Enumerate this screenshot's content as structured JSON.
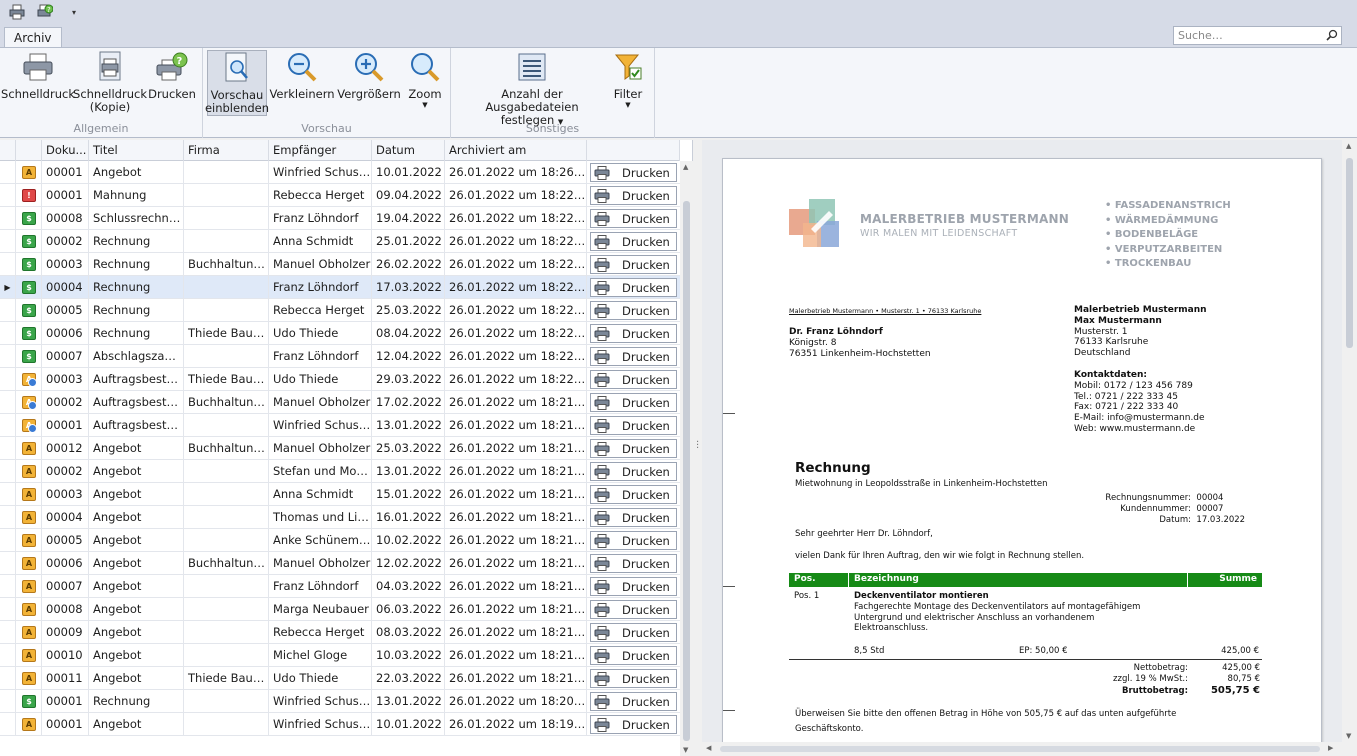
{
  "qat": {
    "icons": [
      "print-icon",
      "print-preview-icon"
    ],
    "menu_arrow": "▾"
  },
  "tabs": [
    {
      "label": "Archiv"
    }
  ],
  "search": {
    "placeholder": "Suche…"
  },
  "ribbon": {
    "groups": [
      {
        "label": "Allgemein",
        "buttons": [
          {
            "line1": "Schnelldruck",
            "line2": ""
          },
          {
            "line1": "Schnelldruck",
            "line2": "(Kopie)"
          },
          {
            "line1": "Drucken",
            "line2": ""
          }
        ]
      },
      {
        "label": "Vorschau",
        "buttons": [
          {
            "line1": "Vorschau",
            "line2": "einblenden"
          },
          {
            "line1": "Verkleinern",
            "line2": ""
          },
          {
            "line1": "Vergrößern",
            "line2": ""
          },
          {
            "line1": "Zoom",
            "line2": ""
          }
        ]
      },
      {
        "label": "Sonstiges",
        "buttons": [
          {
            "line1": "Anzahl der",
            "line2": "Ausgabedateien festlegen"
          },
          {
            "line1": "Filter",
            "line2": ""
          }
        ]
      }
    ]
  },
  "grid": {
    "columns": [
      "Doku...",
      "Titel",
      "Firma",
      "Empfänger",
      "Datum",
      "Archiviert am"
    ],
    "print_label": "Drucken",
    "selected_index": 5,
    "row_indicator": "▶",
    "rows": [
      {
        "type": "angebot",
        "doc": "00001",
        "title": "Angebot",
        "firma": "",
        "recipient": "Winfried Schuster",
        "date": "10.01.2022",
        "archived": "26.01.2022 um 18:26:13 ..."
      },
      {
        "type": "mahnung",
        "doc": "00001",
        "title": "Mahnung",
        "firma": "",
        "recipient": "Rebecca Herget",
        "date": "09.04.2022",
        "archived": "26.01.2022 um 18:22:42 ..."
      },
      {
        "type": "rechnung",
        "doc": "00008",
        "title": "Schlussrechnung",
        "firma": "",
        "recipient": "Franz Löhndorf",
        "date": "19.04.2022",
        "archived": "26.01.2022 um 18:22:28 ..."
      },
      {
        "type": "rechnung",
        "doc": "00002",
        "title": "Rechnung",
        "firma": "",
        "recipient": "Anna Schmidt",
        "date": "25.01.2022",
        "archived": "26.01.2022 um 18:22:03 ..."
      },
      {
        "type": "rechnung",
        "doc": "00003",
        "title": "Rechnung",
        "firma": "Buchhaltungs...",
        "recipient": "Manuel Obholzer",
        "date": "26.02.2022",
        "archived": "26.01.2022 um 18:22:03 ..."
      },
      {
        "type": "rechnung",
        "doc": "00004",
        "title": "Rechnung",
        "firma": "",
        "recipient": "Franz Löhndorf",
        "date": "17.03.2022",
        "archived": "26.01.2022 um 18:22:02 ..."
      },
      {
        "type": "rechnung",
        "doc": "00005",
        "title": "Rechnung",
        "firma": "",
        "recipient": "Rebecca Herget",
        "date": "25.03.2022",
        "archived": "26.01.2022 um 18:22:02 ..."
      },
      {
        "type": "rechnung",
        "doc": "00006",
        "title": "Rechnung",
        "firma": "Thiede Bausta...",
        "recipient": "Udo Thiede",
        "date": "08.04.2022",
        "archived": "26.01.2022 um 18:22:02 ..."
      },
      {
        "type": "rechnung",
        "doc": "00007",
        "title": "Abschlagszahlung",
        "firma": "",
        "recipient": "Franz Löhndorf",
        "date": "12.04.2022",
        "archived": "26.01.2022 um 18:22:02 ..."
      },
      {
        "type": "auftrag",
        "doc": "00003",
        "title": "Auftragsbestäti...",
        "firma": "Thiede Bausta...",
        "recipient": "Udo Thiede",
        "date": "29.03.2022",
        "archived": "26.01.2022 um 18:22:01 ..."
      },
      {
        "type": "auftrag",
        "doc": "00002",
        "title": "Auftragsbestäti...",
        "firma": "Buchhaltungs...",
        "recipient": "Manuel Obholzer",
        "date": "17.02.2022",
        "archived": "26.01.2022 um 18:21:46 ..."
      },
      {
        "type": "auftrag",
        "doc": "00001",
        "title": "Auftragsbestäti...",
        "firma": "",
        "recipient": "Winfried Schuster",
        "date": "13.01.2022",
        "archived": "26.01.2022 um 18:21:46 ..."
      },
      {
        "type": "angebot",
        "doc": "00012",
        "title": "Angebot",
        "firma": "Buchhaltungs...",
        "recipient": "Manuel Obholzer",
        "date": "25.03.2022",
        "archived": "26.01.2022 um 18:21:44 ..."
      },
      {
        "type": "angebot",
        "doc": "00002",
        "title": "Angebot",
        "firma": "",
        "recipient": "Stefan und Monik...",
        "date": "13.01.2022",
        "archived": "26.01.2022 um 18:21:23 ..."
      },
      {
        "type": "angebot",
        "doc": "00003",
        "title": "Angebot",
        "firma": "",
        "recipient": "Anna Schmidt",
        "date": "15.01.2022",
        "archived": "26.01.2022 um 18:21:23 ..."
      },
      {
        "type": "angebot",
        "doc": "00004",
        "title": "Angebot",
        "firma": "",
        "recipient": "Thomas und Lisa ...",
        "date": "16.01.2022",
        "archived": "26.01.2022 um 18:21:23 ..."
      },
      {
        "type": "angebot",
        "doc": "00005",
        "title": "Angebot",
        "firma": "",
        "recipient": "Anke Schünemann",
        "date": "10.02.2022",
        "archived": "26.01.2022 um 18:21:23 ..."
      },
      {
        "type": "angebot",
        "doc": "00006",
        "title": "Angebot",
        "firma": "Buchhaltungs...",
        "recipient": "Manuel Obholzer",
        "date": "12.02.2022",
        "archived": "26.01.2022 um 18:21:22 ..."
      },
      {
        "type": "angebot",
        "doc": "00007",
        "title": "Angebot",
        "firma": "",
        "recipient": "Franz Löhndorf",
        "date": "04.03.2022",
        "archived": "26.01.2022 um 18:21:22 ..."
      },
      {
        "type": "angebot",
        "doc": "00008",
        "title": "Angebot",
        "firma": "",
        "recipient": "Marga Neubauer",
        "date": "06.03.2022",
        "archived": "26.01.2022 um 18:21:22 ..."
      },
      {
        "type": "angebot",
        "doc": "00009",
        "title": "Angebot",
        "firma": "",
        "recipient": "Rebecca Herget",
        "date": "08.03.2022",
        "archived": "26.01.2022 um 18:21:22 ..."
      },
      {
        "type": "angebot",
        "doc": "00010",
        "title": "Angebot",
        "firma": "",
        "recipient": "Michel Gloge",
        "date": "10.03.2022",
        "archived": "26.01.2022 um 18:21:22 ..."
      },
      {
        "type": "angebot",
        "doc": "00011",
        "title": "Angebot",
        "firma": "Thiede Bausta...",
        "recipient": "Udo Thiede",
        "date": "22.03.2022",
        "archived": "26.01.2022 um 18:21:22 ..."
      },
      {
        "type": "rechnung",
        "doc": "00001",
        "title": "Rechnung",
        "firma": "",
        "recipient": "Winfried Schuster",
        "date": "13.01.2022",
        "archived": "26.01.2022 um 18:20:17 ..."
      },
      {
        "type": "angebot",
        "doc": "00001",
        "title": "Angebot",
        "firma": "",
        "recipient": "Winfried Schuster",
        "date": "10.01.2022",
        "archived": "26.01.2022 um 18:19:53 ..."
      }
    ]
  },
  "preview": {
    "logo": {
      "name": "MALERBETRIEB MUSTERMANN",
      "subtitle": "WIR MALEN MIT LEIDENSCHAFT"
    },
    "services": [
      "FASSADENANSTRICH",
      "WÄRMEDÄMMUNG",
      "BODENBELÄGE",
      "VERPUTZARBEITEN",
      "TROCKENBAU"
    ],
    "sender_line": "Malerbetrieb Mustermann • Musterstr. 1 • 76133 Karlsruhe",
    "recipient": {
      "name": "Dr. Franz Löhndorf",
      "street": "Königstr. 8",
      "city": "76351 Linkenheim-Hochstetten"
    },
    "company": {
      "name": "Malerbetrieb Mustermann",
      "owner": "Max Mustermann",
      "street": "Musterstr. 1",
      "city": "76133 Karlsruhe",
      "country": "Deutschland",
      "contact_heading": "Kontaktdaten:",
      "mobile": "Mobil: 0172 / 123 456 789",
      "phone": "Tel.: 0721 / 222 333 45",
      "fax": "Fax: 0721 / 222 333 40",
      "email": "E-Mail: info@mustermann.de",
      "web": "Web: www.mustermann.de"
    },
    "title": "Rechnung",
    "subtitle": "Mietwohnung in Leopoldsstraße in Linkenheim-Hochstetten",
    "meta": [
      {
        "label": "Rechnungsnummer:",
        "value": "00004"
      },
      {
        "label": "Kundennummer:",
        "value": "00007"
      },
      {
        "label": "Datum:",
        "value": "17.03.2022"
      }
    ],
    "greeting": "Sehr geehrter Herr Dr. Löhndorf,",
    "intro": "vielen Dank für Ihren Auftrag, den wir wie folgt in Rechnung stellen.",
    "table_head": {
      "pos": "Pos.",
      "desc": "Bezeichnung",
      "sum": "Summe"
    },
    "position": {
      "pos": "Pos. 1",
      "title": "Deckenventilator montieren",
      "desc1": "Fachgerechte Montage des Deckenventilators auf montagefähigem",
      "desc2": "Untergrund und elektrischer Anschluss an vorhandenem",
      "desc3": "Elektroanschluss.",
      "qty": "8,5 Std",
      "ep": "EP: 50,00 €",
      "sum": "425,00 €"
    },
    "totals": [
      {
        "label": "Nettobetrag:",
        "value": "425,00 €"
      },
      {
        "label": "zzgl. 19 % MwSt.:",
        "value": "80,75 €"
      },
      {
        "label": "Bruttobetrag:",
        "value": "505,75 €"
      }
    ],
    "closing1": "Überweisen Sie bitte den offenen Betrag in Höhe von 505,75 € auf das unten aufgeführte",
    "closing2": "Geschäftskonto."
  },
  "colors": {
    "accent_green": "#168a16",
    "selection": "#dfe9f8"
  }
}
